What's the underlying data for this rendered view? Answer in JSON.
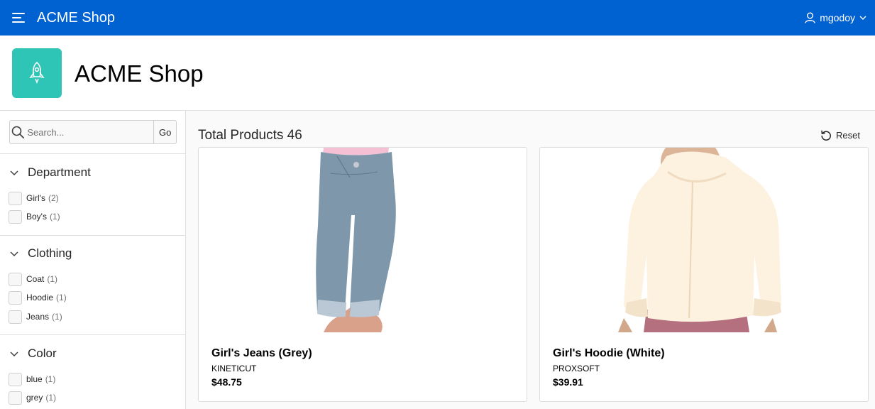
{
  "colors": {
    "brand": "#0062d1",
    "accent": "#2ec4b6",
    "page_bg": "#fafafa"
  },
  "header": {
    "app_title": "ACME Shop",
    "user_name": "mgodoy",
    "icons": [
      "menu-icon",
      "user-icon",
      "chevron-down-icon"
    ]
  },
  "hero": {
    "title": "ACME Shop",
    "icon": "rocket-icon"
  },
  "sidebar": {
    "search": {
      "placeholder": "Search...",
      "value": "",
      "button_label": "Go"
    },
    "facets": [
      {
        "title": "Department",
        "options": [
          {
            "label": "Girl's",
            "count": "(2)"
          },
          {
            "label": "Boy's",
            "count": "(1)"
          }
        ]
      },
      {
        "title": "Clothing",
        "options": [
          {
            "label": "Coat",
            "count": "(1)"
          },
          {
            "label": "Hoodie",
            "count": "(1)"
          },
          {
            "label": "Jeans",
            "count": "(1)"
          }
        ]
      },
      {
        "title": "Color",
        "options": [
          {
            "label": "blue",
            "count": "(1)"
          },
          {
            "label": "grey",
            "count": "(1)"
          }
        ]
      }
    ]
  },
  "main": {
    "total_label": "Total Products 46",
    "reset_label": "Reset",
    "products": [
      {
        "name": "Girl's Jeans (Grey)",
        "brand": "KINETICUT",
        "price": "$48.75",
        "image": "grey-jeans-image"
      },
      {
        "name": "Girl's Hoodie (White)",
        "brand": "PROXSOFT",
        "price": "$39.91",
        "image": "white-hoodie-image"
      }
    ]
  }
}
